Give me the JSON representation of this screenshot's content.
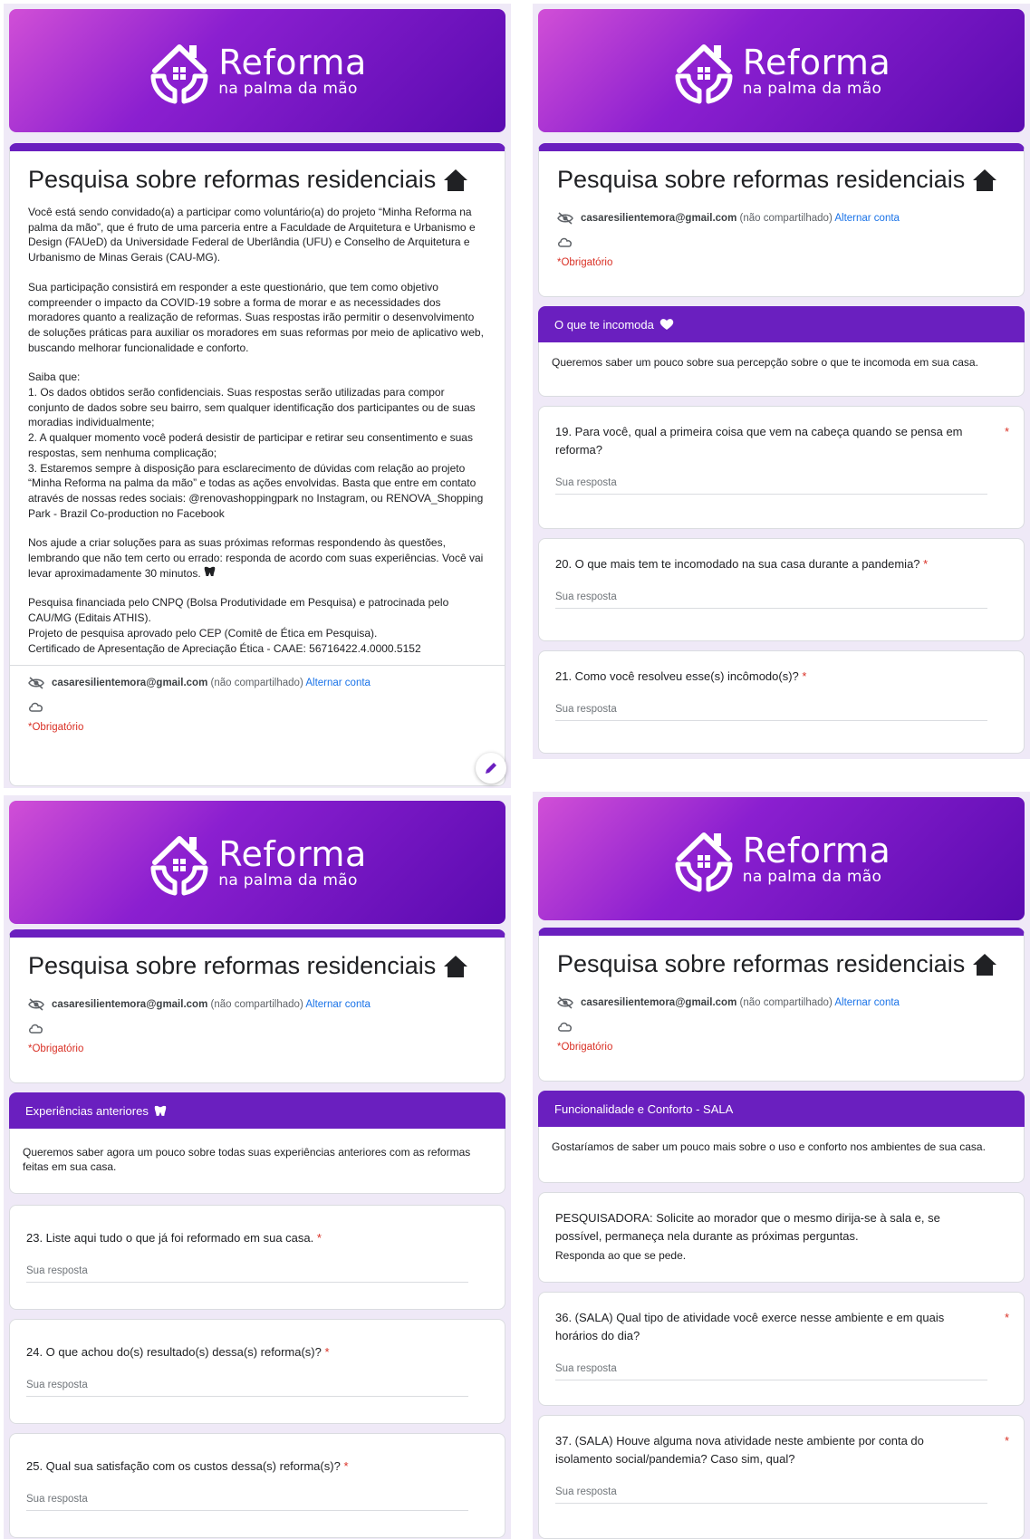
{
  "brand": {
    "title": "Reforma",
    "subtitle": "na palma da mão"
  },
  "form": {
    "title": "Pesquisa sobre reformas residenciais",
    "email": "casaresilientemora@gmail.com",
    "not_shared": "(não compartilhado)",
    "switch_account": "Alternar conta",
    "required": "*Obrigatório",
    "answer_placeholder": "Sua resposta",
    "star": "*"
  },
  "intro": {
    "p1": "Você está sendo convidado(a) a participar como voluntário(a) do projeto “Minha Reforma na palma da mão”, que é fruto de uma parceria entre a Faculdade de Arquitetura e Urbanismo e Design (FAUeD) da Universidade Federal de Uberlândia (UFU) e Conselho de Arquitetura e Urbanismo de Minas Gerais (CAU-MG).",
    "p2": "Sua participação consistirá em responder a este questionário, que tem como objetivo compreender o impacto da COVID-19 sobre a forma de morar e as necessidades dos moradores quanto a realização de reformas. Suas respostas irão permitir o desenvolvimento de soluções práticas para auxiliar os moradores em suas reformas por meio de aplicativo web, buscando melhorar funcionalidade e conforto.",
    "p3_head": "Saiba que:",
    "p3_1": "1.    Os dados obtidos serão confidenciais. Suas respostas serão utilizadas para compor conjunto de dados sobre seu bairro, sem qualquer identificação dos participantes ou de suas moradias individualmente;",
    "p3_2": "2.    A qualquer momento você poderá desistir de participar e retirar seu consentimento e suas respostas, sem nenhuma complicação;",
    "p3_3": "3.    Estaremos sempre à disposição para esclarecimento de dúvidas com relação ao projeto “Minha Reforma na palma da mão” e todas as ações envolvidas. Basta que entre em contato através de nossas redes sociais: @renovashoppingpark no Instagram, ou RENOVA_Shopping Park - Brazil Co-production no Facebook",
    "p4": "Nos ajude a criar soluções para as suas próximas reformas respondendo às questões, lembrando que não tem certo ou errado: responda de acordo com suas experiências. Você vai levar aproximadamente 30 minutos.",
    "p5_1": "Pesquisa financiada pelo CNPQ (Bolsa Produtividade em Pesquisa) e patrocinada pelo CAU/MG (Editais ATHIS).",
    "p5_2": "Projeto de pesquisa aprovado pelo CEP (Comitê de Ética em Pesquisa).",
    "p5_3": "Certificado de Apresentação de Apreciação Ética - CAAE: 56716422.4.0000.5152"
  },
  "section_incomoda": {
    "title": "O que te incomoda",
    "description": "Queremos saber um pouco sobre sua percepção sobre o que te incomoda em sua casa.",
    "q19": "19. Para você, qual a primeira coisa que vem na cabeça quando se pensa em reforma?",
    "q20": "20. O que mais tem te incomodado na sua casa durante a pandemia?",
    "q21": "21. Como você resolveu esse(s) incômodo(s)?"
  },
  "section_experiencias": {
    "title": "Experiências anteriores",
    "description": "Queremos saber agora um pouco sobre todas suas experiências anteriores com as reformas feitas em sua casa.",
    "q23": "23. Liste aqui tudo o que já foi reformado em sua casa.",
    "q24": "24. O que achou do(s) resultado(s) dessa(s) reforma(s)?",
    "q25": "25. Qual sua satisfação com os custos dessa(s) reforma(s)?"
  },
  "section_sala": {
    "title": "Funcionalidade e Conforto - SALA",
    "description": "Gostaríamos de saber um pouco mais sobre o uso e conforto nos ambientes de sua casa.",
    "note": "PESQUISADORA: Solicite ao morador que o mesmo dirija-se à sala e, se possível, permaneça nela durante as próximas perguntas.",
    "note_small": "Responda ao que se pede.",
    "q36": "36. (SALA) Qual tipo de atividade você exerce nesse ambiente e em quais horários do dia?",
    "q37": "37. (SALA) Houve alguma nova atividade neste ambiente por conta do isolamento social/pandemia? Caso sim, qual?"
  },
  "colors": {
    "brand_purple": "#6a1fbf",
    "required_red": "#d93025",
    "link_blue": "#1a73e8"
  }
}
